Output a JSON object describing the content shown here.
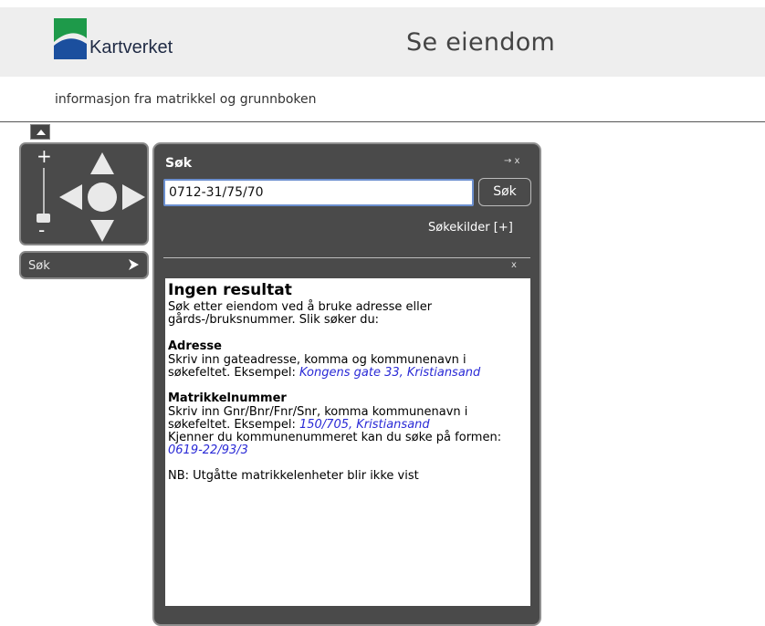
{
  "header": {
    "logo_text": "Kartverket",
    "app_title": "Se eiendom",
    "subtitle": "informasjon fra matrikkel og grunnboken",
    "logo_colors": {
      "green": "#1e9a4a",
      "blue": "#1b4f9e"
    }
  },
  "nav": {
    "zoom_in": "+",
    "zoom_out": "-",
    "search_tab_label": "Søk"
  },
  "search_panel": {
    "title": "Søk",
    "controls": "→ x",
    "input_value": "0712-31/75/70",
    "button_label": "Søk",
    "sources_link": "Søkekilder [+]",
    "results_close": "x",
    "results": {
      "heading": "Ingen resultat",
      "intro": "Søk etter eiendom ved å bruke adresse eller gårds-/bruksnummer. Slik søker du:",
      "address_heading": "Adresse",
      "address_text": "Skriv inn gateadresse, komma og kommunenavn i søkefeltet. Eksempel: ",
      "address_example": "Kongens gate 33, Kristiansand",
      "cadastre_heading": "Matrikkelnummer",
      "cadastre_text": "Skriv inn Gnr/Bnr/Fnr/Snr, komma kommunenavn i søkefeltet. Eksempel: ",
      "cadastre_example": "150/705, Kristiansand",
      "municipality_text": "Kjenner du kommunenummeret kan du søke på formen: ",
      "municipality_example": "0619-22/93/3",
      "note": "NB: Utgåtte matrikkelenheter blir ikke vist"
    }
  }
}
